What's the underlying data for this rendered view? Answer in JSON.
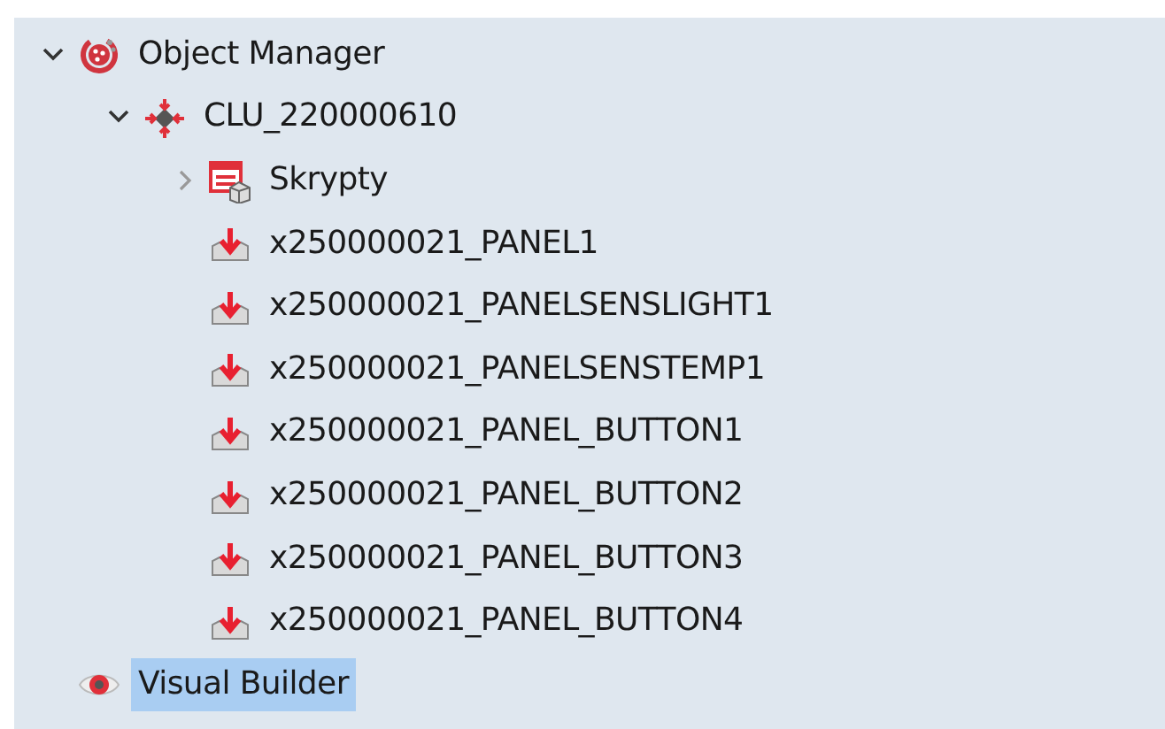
{
  "tree": [
    {
      "label": "Object Manager",
      "kind": "manager",
      "expanded": true,
      "selected": false,
      "children": [
        {
          "label": "CLU_220000610",
          "kind": "clu",
          "expanded": true,
          "selected": false,
          "children": [
            {
              "label": "Skrypty",
              "kind": "scripts",
              "expanded": false,
              "selected": false
            },
            {
              "label": "x250000021_PANEL1",
              "kind": "object",
              "selected": false
            },
            {
              "label": "x250000021_PANELSENSLIGHT1",
              "kind": "object",
              "selected": false
            },
            {
              "label": "x250000021_PANELSENSTEMP1",
              "kind": "object",
              "selected": false
            },
            {
              "label": "x250000021_PANEL_BUTTON1",
              "kind": "object",
              "selected": false
            },
            {
              "label": "x250000021_PANEL_BUTTON2",
              "kind": "object",
              "selected": false
            },
            {
              "label": "x250000021_PANEL_BUTTON3",
              "kind": "object",
              "selected": false
            },
            {
              "label": "x250000021_PANEL_BUTTON4",
              "kind": "object",
              "selected": false
            }
          ]
        }
      ]
    },
    {
      "label": "Visual Builder",
      "kind": "builder",
      "selected": true
    }
  ]
}
